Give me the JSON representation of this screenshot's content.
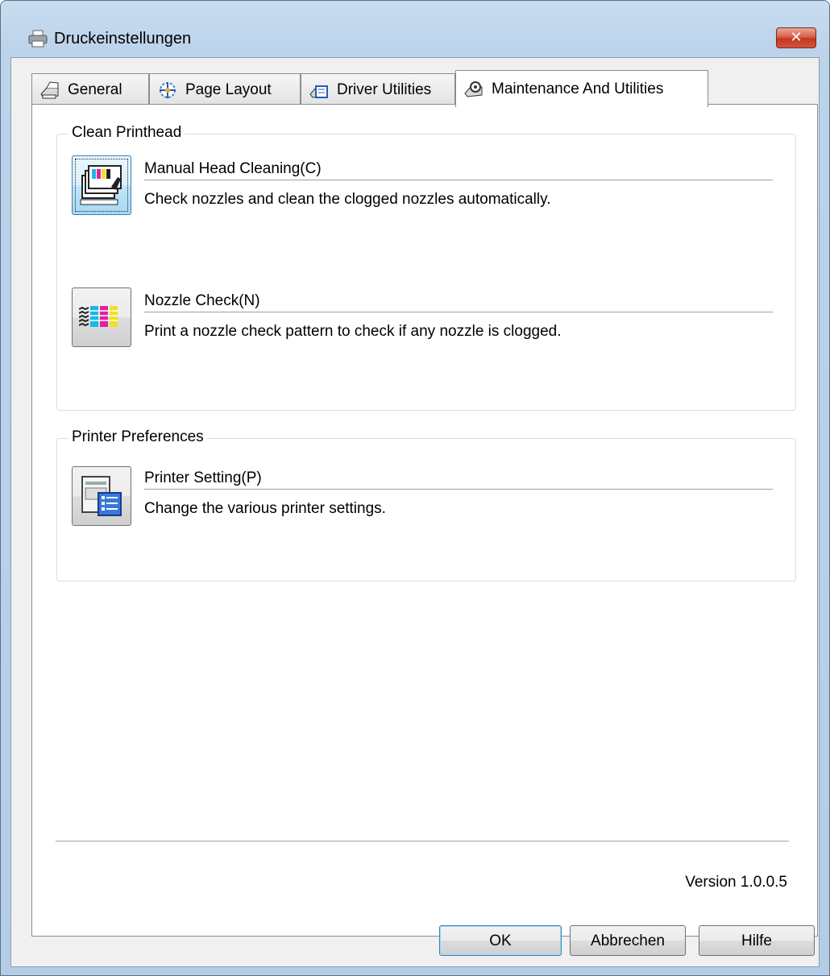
{
  "window": {
    "title": "Druckeinstellungen",
    "close_label": "✕"
  },
  "tabs": [
    {
      "label": "General",
      "icon": "printer-general-icon",
      "active": false
    },
    {
      "label": "Page Layout",
      "icon": "page-layout-icon",
      "active": false
    },
    {
      "label": "Driver Utilities",
      "icon": "driver-utilities-icon",
      "active": false
    },
    {
      "label": "Maintenance And Utilities",
      "icon": "maintenance-icon",
      "active": true
    }
  ],
  "clean_printhead": {
    "label": "Clean Printhead",
    "manual_head_cleaning": {
      "title": "Manual Head Cleaning(C)",
      "description": "Check nozzles and clean the clogged nozzles automatically.",
      "icon": "head-cleaning-icon"
    },
    "nozzle_check": {
      "title": "Nozzle Check(N)",
      "description": "Print a nozzle check pattern to check if any nozzle is clogged.",
      "icon": "nozzle-pattern-icon"
    }
  },
  "printer_preferences": {
    "label": "Printer Preferences",
    "printer_setting": {
      "title": "Printer Setting(P)",
      "description": "Change the various printer settings.",
      "icon": "printer-settings-icon"
    }
  },
  "version": "Version 1.0.0.5",
  "buttons": {
    "ok": "OK",
    "cancel": "Abbrechen",
    "help": "Hilfe"
  }
}
